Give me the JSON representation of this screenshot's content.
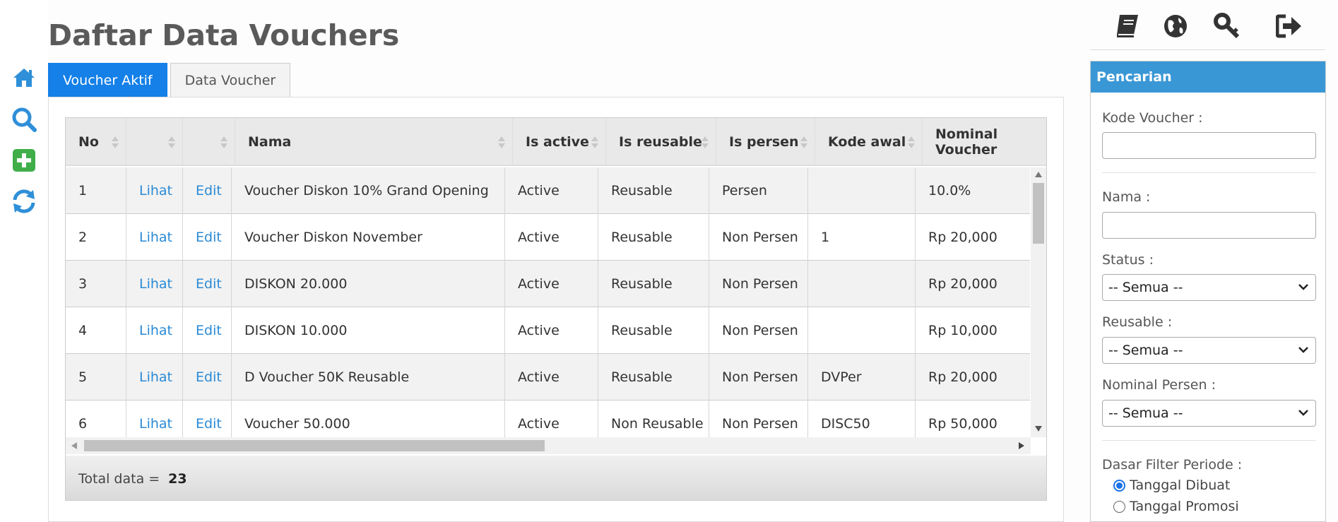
{
  "page": {
    "title": "Daftar Data Vouchers"
  },
  "left_rail": {
    "icons": [
      "home-icon",
      "search-icon",
      "add-icon",
      "refresh-icon"
    ],
    "accent": "#2f8fd8",
    "add_color": "#3fae49"
  },
  "top_icons": [
    "book-icon",
    "globe-icon",
    "key-icon",
    "logout-icon"
  ],
  "tabs": [
    {
      "label": "Voucher Aktif",
      "active": true
    },
    {
      "label": "Data Voucher",
      "active": false
    }
  ],
  "table": {
    "headers": [
      "No",
      "",
      "",
      "Nama",
      "Is active",
      "Is reusable",
      "Is persen",
      "Kode awal",
      "Nominal Voucher"
    ],
    "rows": [
      {
        "no": "1",
        "view": "Lihat",
        "edit": "Edit",
        "nama": "Voucher Diskon 10% Grand Opening",
        "active": "Active",
        "reusable": "Reusable",
        "persen": "Persen",
        "kode": "",
        "nominal": "10.0%"
      },
      {
        "no": "2",
        "view": "Lihat",
        "edit": "Edit",
        "nama": "Voucher Diskon November",
        "active": "Active",
        "reusable": "Reusable",
        "persen": "Non Persen",
        "kode": "1",
        "nominal": "Rp 20,000"
      },
      {
        "no": "3",
        "view": "Lihat",
        "edit": "Edit",
        "nama": "DISKON 20.000",
        "active": "Active",
        "reusable": "Reusable",
        "persen": "Non Persen",
        "kode": "",
        "nominal": "Rp 20,000"
      },
      {
        "no": "4",
        "view": "Lihat",
        "edit": "Edit",
        "nama": "DISKON 10.000",
        "active": "Active",
        "reusable": "Reusable",
        "persen": "Non Persen",
        "kode": "",
        "nominal": "Rp 10,000"
      },
      {
        "no": "5",
        "view": "Lihat",
        "edit": "Edit",
        "nama": "D Voucher 50K Reusable",
        "active": "Active",
        "reusable": "Reusable",
        "persen": "Non Persen",
        "kode": "DVPer",
        "nominal": "Rp 20,000"
      },
      {
        "no": "6",
        "view": "Lihat",
        "edit": "Edit",
        "nama": "Voucher 50.000",
        "active": "Active",
        "reusable": "Non Reusable",
        "persen": "Non Persen",
        "kode": "DISC50",
        "nominal": "Rp 50,000"
      }
    ],
    "footer_label": "Total data =",
    "footer_total": "23"
  },
  "search_panel": {
    "title": "Pencarian",
    "kode_label": "Kode Voucher :",
    "kode_value": "",
    "nama_label": "Nama :",
    "nama_value": "",
    "status_label": "Status :",
    "status_value": "-- Semua --",
    "reusable_label": "Reusable :",
    "reusable_value": "-- Semua --",
    "nominal_label": "Nominal Persen :",
    "nominal_value": "-- Semua --",
    "periode_label": "Dasar Filter Periode :",
    "periode_options": [
      {
        "label": "Tanggal Dibuat",
        "checked": true
      },
      {
        "label": "Tanggal Promosi",
        "checked": false
      }
    ]
  }
}
